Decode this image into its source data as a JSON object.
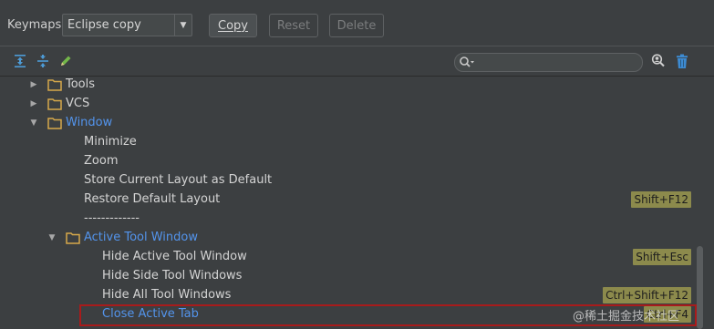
{
  "keymaps": {
    "label": "Keymaps:",
    "selected": "Eclipse copy",
    "buttons": {
      "copy": "Copy",
      "reset": "Reset",
      "delete": "Delete"
    }
  },
  "toolbar": {
    "icons": [
      "expand-all-icon",
      "collapse-all-icon",
      "edit-pencil-icon",
      "find-by-shortcut-icon",
      "trash-icon"
    ],
    "search": {
      "value": "",
      "placeholder": ""
    }
  },
  "tree": {
    "rows": [
      {
        "label": "Tools",
        "type": "folder",
        "expanded": false
      },
      {
        "label": "VCS",
        "type": "folder",
        "expanded": false
      },
      {
        "label": "Window",
        "type": "folder",
        "expanded": true
      },
      {
        "label": "Minimize",
        "type": "action"
      },
      {
        "label": "Zoom",
        "type": "action"
      },
      {
        "label": "Store Current Layout as Default",
        "type": "action"
      },
      {
        "label": "Restore Default Layout",
        "type": "action",
        "shortcut": "Shift+F12"
      },
      {
        "label": "-------------",
        "type": "separator"
      },
      {
        "label": "Active Tool Window",
        "type": "folder",
        "expanded": true
      },
      {
        "label": "Hide Active Tool Window",
        "type": "action",
        "shortcut": "Shift+Esc"
      },
      {
        "label": "Hide Side Tool Windows",
        "type": "action"
      },
      {
        "label": "Hide All Tool Windows",
        "type": "action",
        "shortcut": "Ctrl+Shift+F12"
      },
      {
        "label": "Close Active Tab",
        "type": "action",
        "shortcut": "Ctrl+F4",
        "selected": true
      }
    ]
  },
  "watermark": "@稀土掘金技术社区",
  "colors": {
    "background": "#3c3f41",
    "folder": "#d7a94b",
    "link_blue": "#5394ec",
    "shortcut_bg": "#8c8a4c",
    "selection_border": "#a81b1b"
  }
}
